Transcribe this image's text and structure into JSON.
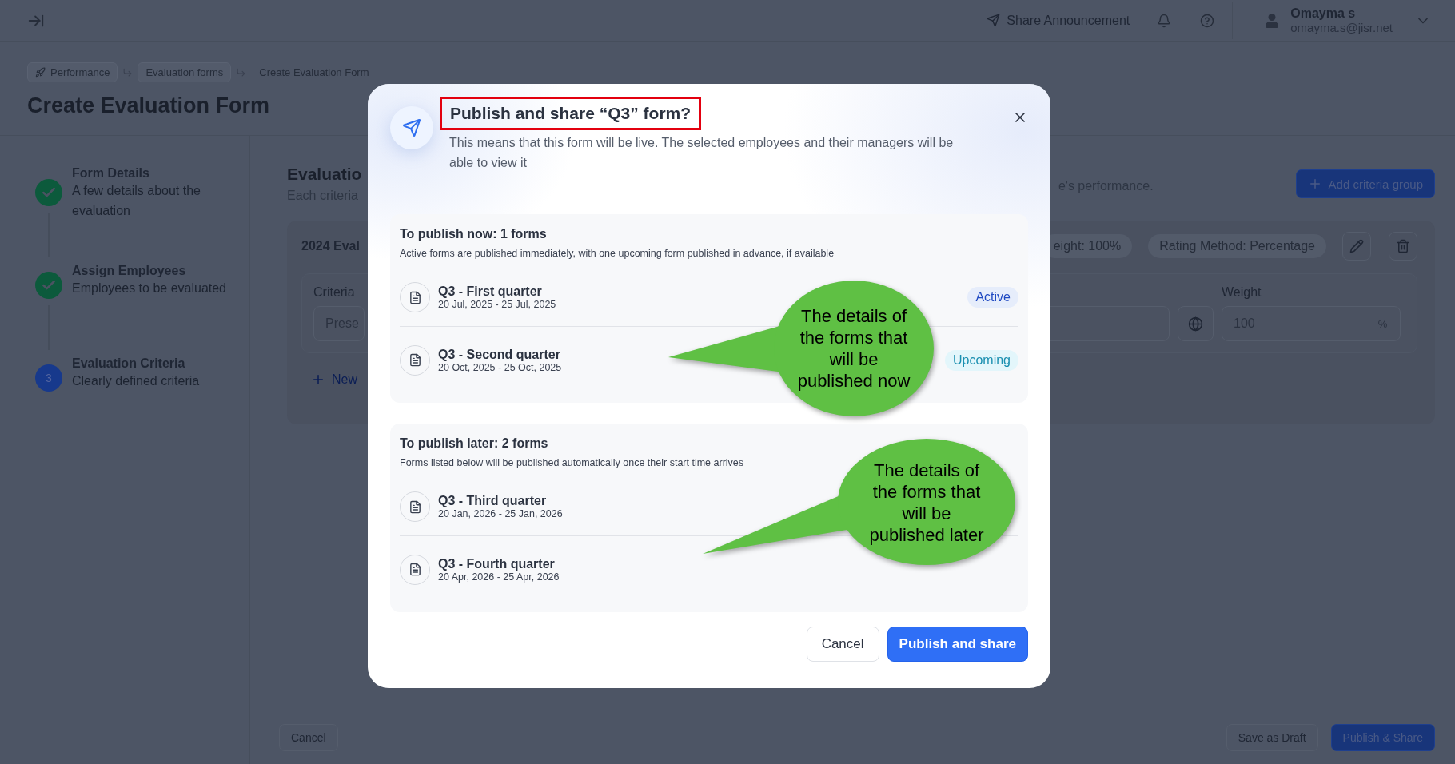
{
  "top_bar": {
    "share_announcement": "Share Announcement",
    "user": {
      "name": "Omayma s",
      "email": "omayma.s@jisr.net"
    }
  },
  "breadcrumb": [
    "Performance",
    "Evaluation forms",
    "Create Evaluation Form"
  ],
  "page_title": "Create Evaluation Form",
  "steps": [
    {
      "title": "Form Details",
      "description": "A few details about the evaluation",
      "completed": true
    },
    {
      "title": "Assign Employees",
      "description": "Employees to be evaluated",
      "completed": true
    },
    {
      "title": "Evaluation Criteria",
      "description": "Clearly defined criteria",
      "completed": false,
      "number": "3"
    }
  ],
  "criteria_section": {
    "title": "Evaluatio",
    "description_start": "Each criteria",
    "description_end": "e's performance.",
    "add_button": "Add criteria group"
  },
  "criteria_group": {
    "name": "2024 Eval",
    "chips": [
      "eight: 100%",
      "Rating Method: Percentage"
    ],
    "criteria_label": "Criteria",
    "criteria_value": "Prese",
    "weight_label": "Weight",
    "weight_value": "100",
    "weight_unit": "%",
    "new_link": "New"
  },
  "footer": {
    "cancel": "Cancel",
    "save_draft": "Save as Draft",
    "publish": "Publish & Share"
  },
  "dialog": {
    "title": "Publish and share “Q3” form?",
    "highlighted": true,
    "description": "This means that this form will be live. The selected employees and their managers will be able to view it",
    "sections": [
      {
        "title": "To publish now: 1 forms",
        "description": "Active forms are published immediately, with one upcoming form published in advance, if available",
        "forms": [
          {
            "name": "Q3 - First quarter",
            "dates": "20 Jul, 2025 - 25 Jul, 2025",
            "status": "Active",
            "kind": "active"
          },
          {
            "name": "Q3 - Second quarter",
            "dates": "20 Oct, 2025 - 25 Oct, 2025",
            "status": "Upcoming",
            "kind": "upcoming"
          }
        ]
      },
      {
        "title": "To publish later: 2 forms",
        "description": "Forms listed below will be published automatically once their start time arrives",
        "forms": [
          {
            "name": "Q3 - Third quarter",
            "dates": "20 Jan, 2026 - 25 Jan, 2026"
          },
          {
            "name": "Q3 - Fourth quarter",
            "dates": "20 Apr, 2026 - 25 Apr, 2026"
          }
        ]
      }
    ],
    "cancel": "Cancel",
    "confirm": "Publish and share"
  },
  "annotations": [
    {
      "text": "The details of the forms that will be published now"
    },
    {
      "text": "The details of the forms that will be published later"
    }
  ]
}
